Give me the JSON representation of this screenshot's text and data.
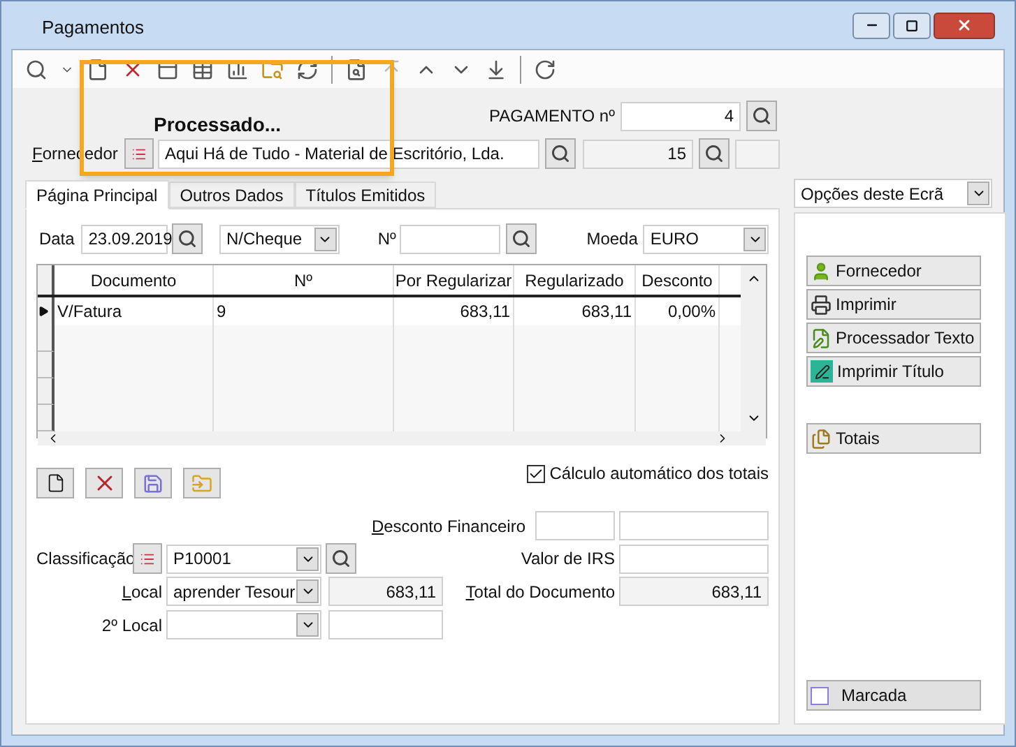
{
  "window": {
    "title": "Pagamentos"
  },
  "overlay": {
    "text": "Processado..."
  },
  "header": {
    "payment_label": "PAGAMENTO nº",
    "payment_number": "4",
    "supplier_label": "Fornecedor",
    "supplier_mnemonic": true,
    "supplier_name": "Aqui Há de Tudo - Material de Escritório, Lda.",
    "supplier_code": "15"
  },
  "tabs": [
    {
      "label": "Página Principal",
      "selected": true
    },
    {
      "label": "Outros Dados",
      "selected": false
    },
    {
      "label": "Títulos Emitidos",
      "selected": false
    }
  ],
  "filters": {
    "date_label": "Data",
    "date": "23.09.2019",
    "type": "N/Cheque",
    "number_label": "Nº",
    "currency_label": "Moeda",
    "currency": "EURO"
  },
  "table": {
    "columns": [
      "Documento",
      "Nº",
      "Por Regularizar",
      "Regularizado",
      "Desconto"
    ],
    "rows": [
      {
        "cells": [
          "V/Fatura",
          "9",
          "683,11",
          "683,11",
          "0,00%"
        ],
        "current": true
      }
    ]
  },
  "auto_totals": {
    "label": "Cálculo automático dos totais",
    "checked": true
  },
  "financial_discount": {
    "label": "Desconto Financeiro",
    "mnemonic": true
  },
  "classification": {
    "label": "Classificação",
    "value": "P10001"
  },
  "local": {
    "label": "Local",
    "mnemonic": true,
    "value": "aprender   Tesour",
    "amount": "683,11"
  },
  "irs": {
    "label": "Valor de IRS"
  },
  "total": {
    "label": "Total do Documento",
    "mnemonic": true,
    "value": "683,11"
  },
  "local2": {
    "label": "2º Local"
  },
  "side": {
    "dropdown": "Opções deste Ecrã",
    "buttons": [
      {
        "kind": "person",
        "label": "Fornecedor"
      },
      {
        "kind": "printer",
        "label": "Imprimir"
      },
      {
        "kind": "document",
        "label": "Processador Texto"
      },
      {
        "kind": "pen",
        "label": "Imprimir Título"
      },
      {
        "kind": "totals",
        "label": "Totais"
      }
    ],
    "marked": {
      "label": "Marcada",
      "checked": false
    }
  }
}
